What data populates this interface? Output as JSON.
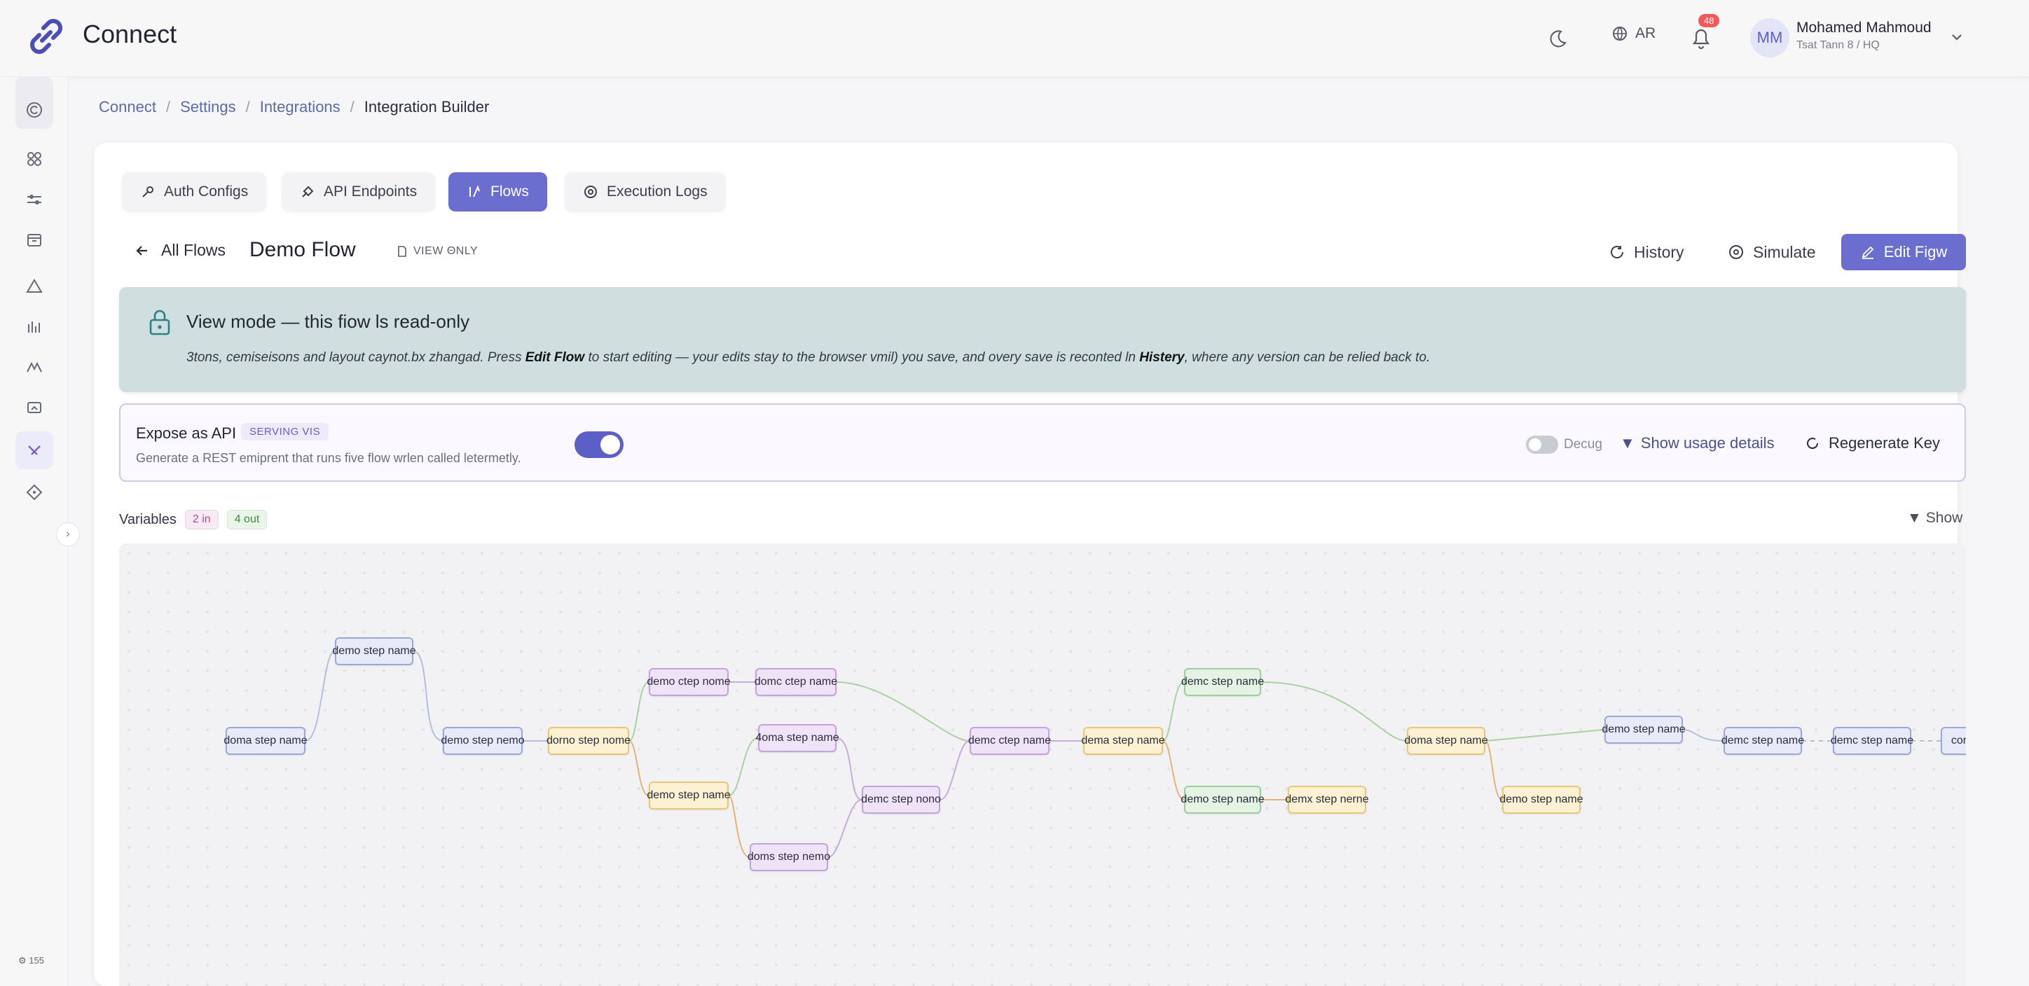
{
  "header": {
    "app_title": "Connect",
    "lang": "AR",
    "notif_count": "48",
    "user_initials": "MM",
    "user_name": "Mohamed Mahmoud",
    "user_sub": "Tsat Tann 8 / HQ"
  },
  "sidebar": {
    "items": [
      "copyright-icon",
      "apps-icon",
      "sliders-icon",
      "archive-icon",
      "triangle-icon",
      "bar-chart-icon",
      "activity-icon",
      "monitor-icon",
      "integrations-icon",
      "tag-icon"
    ],
    "selected": "integrations-icon",
    "footer": "⚙ 155"
  },
  "breadcrumb": [
    "Connect",
    "Settings",
    "Integrations",
    "Integration Builder"
  ],
  "tabs": [
    {
      "label": "Auth Configs",
      "icon": "key-icon",
      "active": false
    },
    {
      "label": "API Endpoints",
      "icon": "plug-icon",
      "active": false
    },
    {
      "label": "Flows",
      "icon": "flow-icon",
      "active": true
    },
    {
      "label": "Execution Logs",
      "icon": "log-icon",
      "active": false
    }
  ],
  "flow": {
    "back_label": "All Flows",
    "title": "Demo Flow",
    "view_only_label": "VIEW ΘΝLY",
    "actions": {
      "history": "History",
      "simulate": "Simulate",
      "edit": "Edit Figw"
    }
  },
  "banner": {
    "title": "View mode — this fiow ls read-only",
    "text_a": "3tons, cemiseisons and layout caynot.bx zhangad. Press ",
    "text_b": "Edit Flow",
    "text_c": " to start editing — your edits stay to the browser vmil) you save, and overy save is reconted ln ",
    "text_d": "Histery",
    "text_e": ", where any version can be relied back to."
  },
  "api": {
    "title": "Expose as API",
    "badge": "SERVING VIS",
    "subtitle": "Generate a REST emiprent that runs five flow wrlen called letermetly.",
    "enabled": true,
    "debug_label": "Decug",
    "usage_link": "Show usage details",
    "regen": "Regenerate Key"
  },
  "variables": {
    "label": "Variables",
    "in": "2 in",
    "out": "4 out",
    "show": "Show"
  },
  "colors": {
    "accent": "#6c6ecf",
    "banner": "#cfdede",
    "node_blue": "#e7eaf8",
    "node_yellow": "#fcf1d2",
    "node_purple": "#efe3f7",
    "node_green": "#e4f3e3"
  },
  "graph": {
    "nodes": [
      {
        "id": "a1",
        "label": "doma step name",
        "kind": "blue"
      },
      {
        "id": "a2",
        "label": "demo step name",
        "kind": "blue"
      },
      {
        "id": "a3",
        "label": "demo step nemo",
        "kind": "blue"
      },
      {
        "id": "a4",
        "label": "dorno step nome",
        "kind": "yellow"
      },
      {
        "id": "b1",
        "label": "demo ctep nome",
        "kind": "purple"
      },
      {
        "id": "b2",
        "label": "demo step name",
        "kind": "yellow"
      },
      {
        "id": "b3",
        "label": "domc ctep name",
        "kind": "purple"
      },
      {
        "id": "b4",
        "label": "4oma step name",
        "kind": "purple"
      },
      {
        "id": "b5",
        "label": "doms step nemo",
        "kind": "purple"
      },
      {
        "id": "b6",
        "label": "demc step nono",
        "kind": "purple"
      },
      {
        "id": "c1",
        "label": "demc ctep name",
        "kind": "purple"
      },
      {
        "id": "c2",
        "label": "dema step name",
        "kind": "yellow"
      },
      {
        "id": "c3",
        "label": "demc step name",
        "kind": "green"
      },
      {
        "id": "c4",
        "label": "demo step name",
        "kind": "green"
      },
      {
        "id": "c5",
        "label": "demx step nerne",
        "kind": "yellow"
      },
      {
        "id": "d1",
        "label": "doma step name",
        "kind": "yellow"
      },
      {
        "id": "d2",
        "label": "demo step name",
        "kind": "yellow"
      },
      {
        "id": "d3",
        "label": "demo step name",
        "kind": "blue"
      },
      {
        "id": "d4",
        "label": "demc step name",
        "kind": "blue"
      },
      {
        "id": "d5",
        "label": "demc step name",
        "kind": "blue"
      },
      {
        "id": "d6",
        "label": "com",
        "kind": "blue"
      }
    ]
  }
}
